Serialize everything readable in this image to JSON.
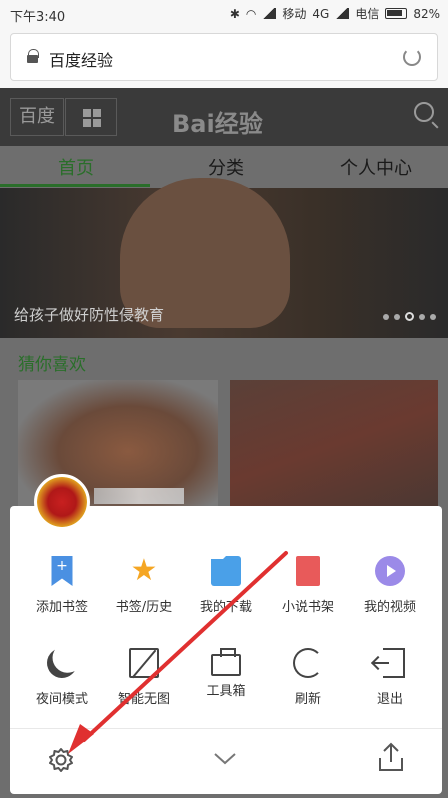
{
  "status_bar": {
    "time": "下午3:40",
    "carrier1": "移动",
    "net": "4G",
    "carrier2": "电信",
    "battery": "82%"
  },
  "address_bar": {
    "url": "百度经验"
  },
  "header": {
    "baidu_label": "百度",
    "logo": "Bai经验"
  },
  "tabs": [
    {
      "label": "首页"
    },
    {
      "label": "分类"
    },
    {
      "label": "个人中心"
    }
  ],
  "banner": {
    "caption": "给孩子做好防性侵教育"
  },
  "section": {
    "title": "猜你喜欢"
  },
  "menu": {
    "row1": [
      {
        "label": "添加书签",
        "icon": "bookmark-add-icon"
      },
      {
        "label": "书签/历史",
        "icon": "star-icon"
      },
      {
        "label": "我的下载",
        "icon": "folder-icon"
      },
      {
        "label": "小说书架",
        "icon": "book-icon"
      },
      {
        "label": "我的视频",
        "icon": "play-icon"
      }
    ],
    "row2": [
      {
        "label": "夜间模式",
        "icon": "moon-icon"
      },
      {
        "label": "智能无图",
        "icon": "no-image-icon"
      },
      {
        "label": "工具箱",
        "icon": "toolbox-icon"
      },
      {
        "label": "刷新",
        "icon": "refresh-icon"
      },
      {
        "label": "退出",
        "icon": "exit-icon"
      }
    ]
  },
  "colors": {
    "accent_green": "#2a6e2a",
    "annotation_red": "#e03030"
  }
}
